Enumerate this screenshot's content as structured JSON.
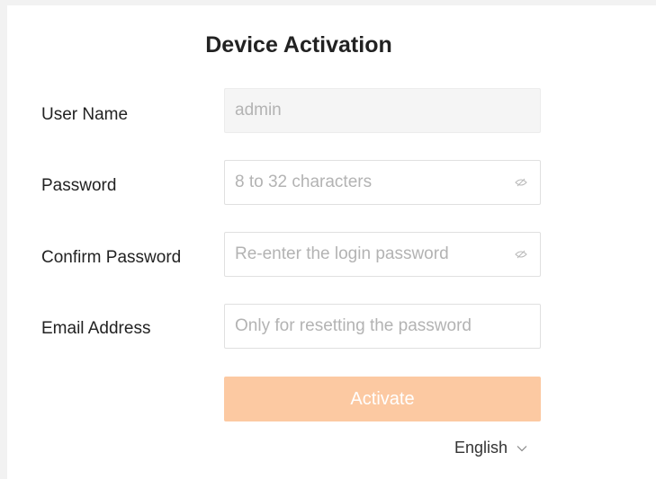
{
  "title": "Device Activation",
  "form": {
    "username": {
      "label": "User Name",
      "value": "admin"
    },
    "password": {
      "label": "Password",
      "placeholder": "8 to 32 characters",
      "icon": "eye-off-icon"
    },
    "confirm_password": {
      "label": "Confirm Password",
      "placeholder": "Re-enter the login password",
      "icon": "eye-off-icon"
    },
    "email": {
      "label": "Email Address",
      "placeholder": "Only for resetting the password"
    },
    "activate_label": "Activate"
  },
  "language": {
    "selected": "English",
    "icon": "chevron-down-icon"
  },
  "colors": {
    "button_bg": "#fcc9a2",
    "button_text": "#ffffff",
    "placeholder": "#b3b3b3",
    "label": "#222222",
    "border": "#e0e0e0"
  }
}
